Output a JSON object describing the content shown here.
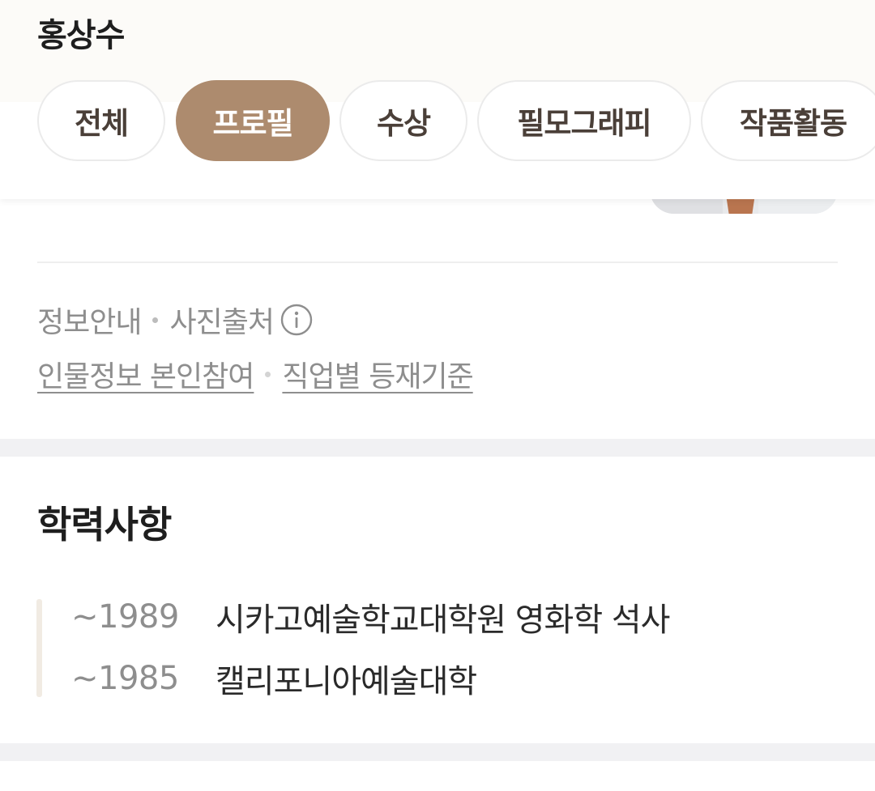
{
  "header": {
    "title": "홍상수",
    "tabs": [
      {
        "label": "전체",
        "active": false
      },
      {
        "label": "프로필",
        "active": true
      },
      {
        "label": "수상",
        "active": false
      },
      {
        "label": "필모그래피",
        "active": false
      },
      {
        "label": "작품활동",
        "active": false
      }
    ]
  },
  "info": {
    "guide_label": "정보안내",
    "photo_source_label": "사진출처",
    "links": [
      "인물정보 본인참여",
      "직업별 등재기준"
    ]
  },
  "education": {
    "title": "학력사항",
    "entries": [
      {
        "year": "~1989",
        "desc": "시카고예술학교대학원 영화학 석사"
      },
      {
        "year": "~1985",
        "desc": "캘리포니아예술대학"
      }
    ]
  },
  "colors": {
    "accent": "#ad8b6e",
    "muted_text": "#8e8e8e",
    "section_gap": "#f1f1f3"
  }
}
